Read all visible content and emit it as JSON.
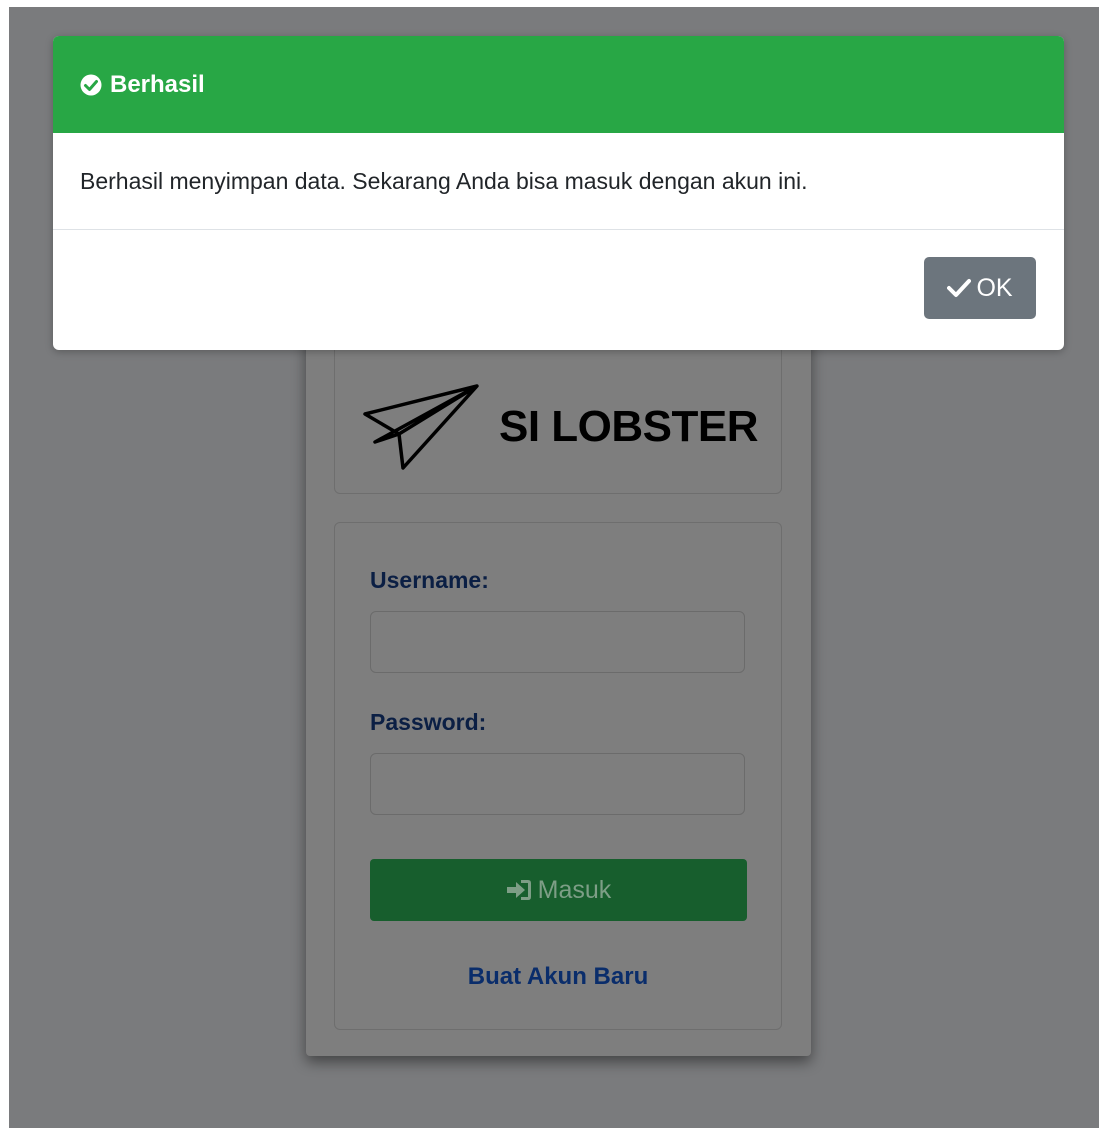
{
  "modal": {
    "title": "Berhasil",
    "message": "Berhasil menyimpan data. Sekarang Anda bisa masuk dengan akun ini.",
    "ok_label": "OK",
    "header_color": "#28a745",
    "ok_color": "#6c757d",
    "title_icon": "check-circle-icon",
    "ok_icon": "check-icon"
  },
  "login": {
    "brand": "SI LOBSTER",
    "brand_icon": "paper-plane-icon",
    "username_label": "Username:",
    "username_value": "",
    "password_label": "Password:",
    "password_value": "",
    "submit_label": "Masuk",
    "submit_icon": "sign-in-icon",
    "register_link": "Buat Akun Baru",
    "submit_color": "#175e2d"
  }
}
